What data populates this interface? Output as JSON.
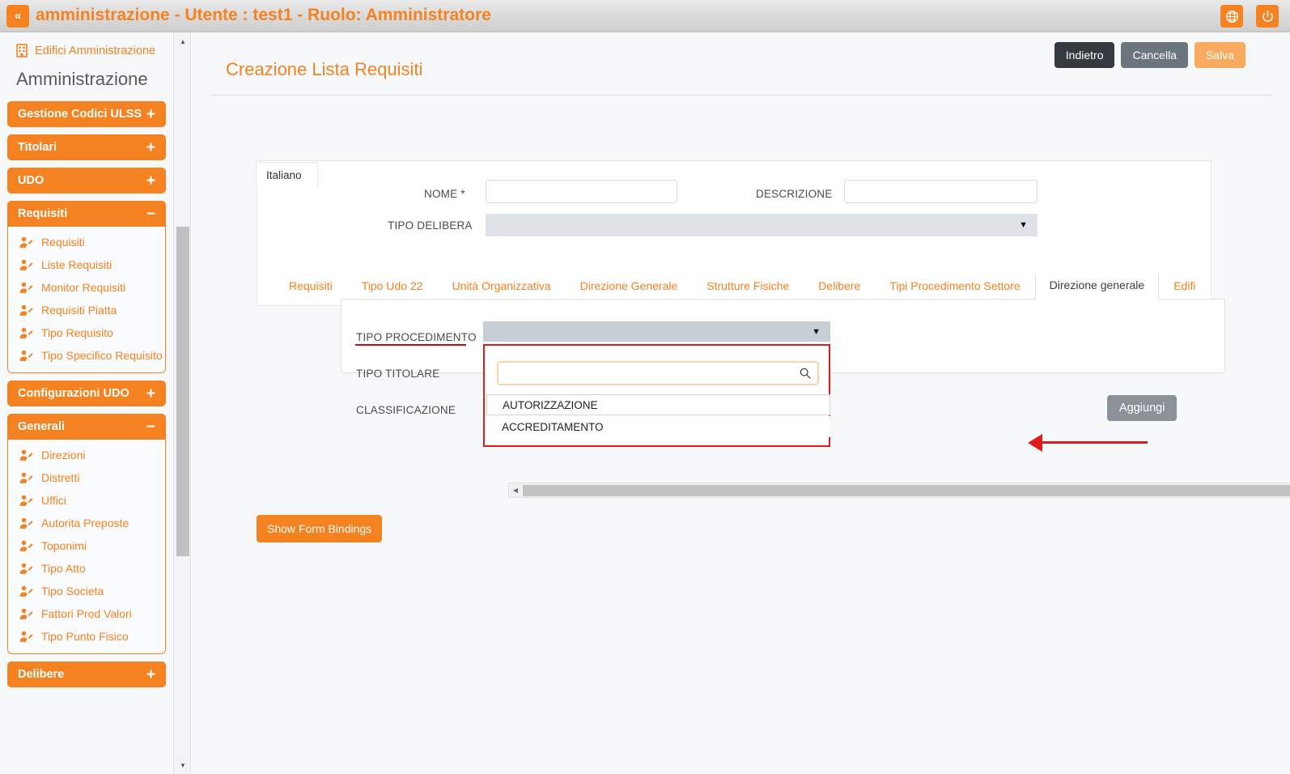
{
  "topbar": {
    "collapse_label": "«",
    "title": "amministrazione - Utente : test1 - Ruolo: Amministratore",
    "globe_icon": "globe-icon",
    "power_icon": "power-icon"
  },
  "sidebar": {
    "top_link": {
      "label": "Edifici Amministrazione",
      "icon": "building-icon"
    },
    "heading": "Amministrazione",
    "groups": [
      {
        "label": "Gestione Codici ULSS",
        "sign": "+",
        "open": false,
        "items": []
      },
      {
        "label": "Titolari",
        "sign": "+",
        "open": false,
        "items": []
      },
      {
        "label": "UDO",
        "sign": "+",
        "open": false,
        "items": []
      },
      {
        "label": "Requisiti",
        "sign": "−",
        "open": true,
        "items": [
          "Requisiti",
          "Liste Requisiti",
          "Monitor Requisiti",
          "Requisiti Piatta",
          "Tipo Requisito",
          "Tipo Specifico Requisito"
        ]
      },
      {
        "label": "Configurazioni UDO",
        "sign": "+",
        "open": false,
        "items": []
      },
      {
        "label": "Generali",
        "sign": "−",
        "open": true,
        "items": [
          "Direzioni",
          "Distretti",
          "Uffici",
          "Autorita Preposte",
          "Toponimi",
          "Tipo Atto",
          "Tipo Societa",
          "Fattori Prod Valori",
          "Tipo Punto Fisico"
        ]
      },
      {
        "label": "Delibere",
        "sign": "+",
        "open": false,
        "items": []
      }
    ]
  },
  "header": {
    "page_title": "Creazione Lista Requisiti",
    "buttons": {
      "back": "Indietro",
      "cancel": "Cancella",
      "save": "Salva"
    }
  },
  "form": {
    "lang_tab": "Italiano",
    "nome_label": "NOME *",
    "nome_value": "",
    "descrizione_label": "DESCRIZIONE",
    "descrizione_value": "",
    "tipo_delibera_label": "TIPO DELIBERA",
    "tipo_delibera_value": "",
    "caret": "▼"
  },
  "tabs": [
    {
      "label": "Requisiti",
      "active": false
    },
    {
      "label": "Tipo Udo 22",
      "active": false
    },
    {
      "label": "Unità Organizzativa",
      "active": false
    },
    {
      "label": "Direzione Generale",
      "active": false
    },
    {
      "label": "Strutture Fisiche",
      "active": false
    },
    {
      "label": "Delibere",
      "active": false
    },
    {
      "label": "Tipi Procedimento Settore",
      "active": false
    },
    {
      "label": "Direzione generale",
      "active": true
    },
    {
      "label": "Edifi",
      "active": false
    }
  ],
  "panel": {
    "tipo_procedimento_label": "TIPO PROCEDIMENTO",
    "tipo_procedimento_value": "",
    "tipo_titolare_label": "TIPO TITOLARE",
    "classificazione_label": "CLASSIFICAZIONE",
    "add_button": "Aggiungi",
    "caret": "▼"
  },
  "dropdown": {
    "search_value": "",
    "search_placeholder": "",
    "search_icon": "search-icon",
    "options": [
      "AUTORIZZAZIONE",
      "ACCREDITAMENTO"
    ]
  },
  "scrollbars": {
    "up_arrow": "▲",
    "down_arrow": "▼",
    "left_arrow": "◀",
    "right_arrow": "▶"
  },
  "footer": {
    "show_bindings": "Show Form Bindings"
  },
  "colors": {
    "accent": "#f58220",
    "annotation": "#e01b1b",
    "dark_button": "#343a40",
    "gray_button": "#6c757d",
    "save_button": "#f8ab5e"
  }
}
